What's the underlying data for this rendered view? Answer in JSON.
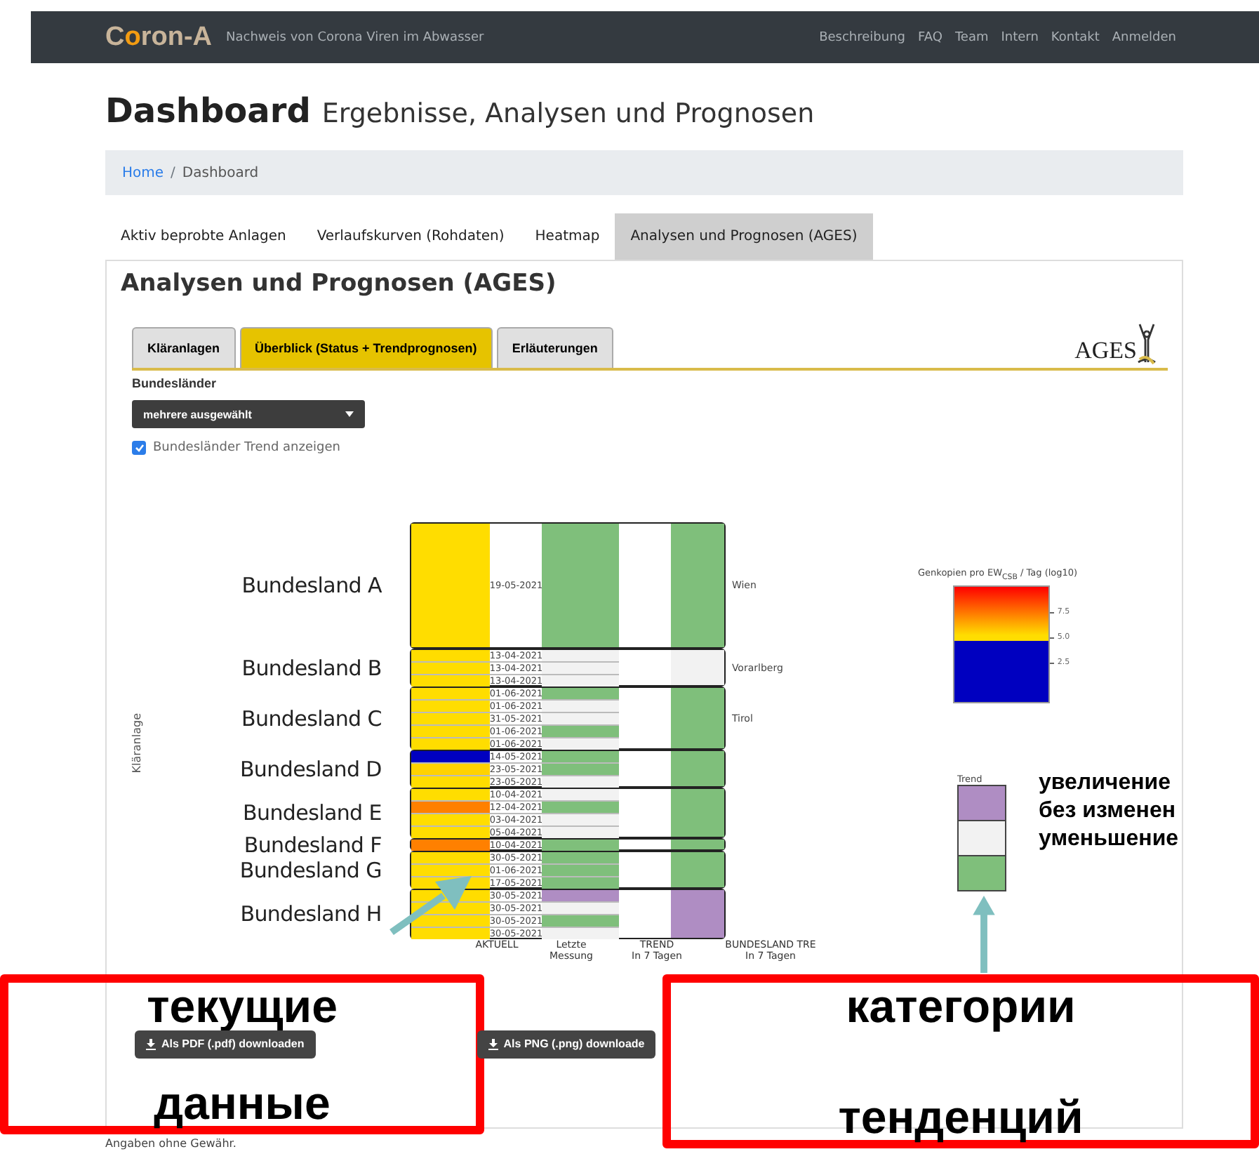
{
  "navbar": {
    "logo": "Coron-A",
    "tagline": "Nachweis von Corona Viren im Abwasser",
    "links": [
      "Beschreibung",
      "FAQ",
      "Team",
      "Intern",
      "Kontakt",
      "Anmelden"
    ]
  },
  "page_title": {
    "title": "Dashboard",
    "subtitle": "Ergebnisse, Analysen und Prognosen"
  },
  "breadcrumb": {
    "separator": "/",
    "items": [
      {
        "label": "Home",
        "kind": "link"
      },
      {
        "label": "Dashboard",
        "kind": "current"
      }
    ]
  },
  "tabs": [
    {
      "label": "Aktiv beprobte Anlagen",
      "selected": false
    },
    {
      "label": "Verlaufskurven (Rohdaten)",
      "selected": false
    },
    {
      "label": "Heatmap",
      "selected": false
    },
    {
      "label": "Analysen und Prognosen (AGES)",
      "selected": true
    }
  ],
  "panel": {
    "title": "Analysen und Prognosen (AGES)",
    "logo": "AGES",
    "subtabs": [
      {
        "label": "Kläranlagen",
        "selected": false
      },
      {
        "label": "Überblick (Status + Trendprognosen)",
        "selected": true
      },
      {
        "label": "Erläuterungen",
        "selected": false
      }
    ],
    "filter": {
      "label": "Bundesländer",
      "value": "mehrere ausgewählt"
    },
    "trend_checkbox": {
      "label": "Bundesländer Trend anzeigen",
      "checked": true
    },
    "heatmap": {
      "ylabel": "Kläranlage",
      "groups": [
        {
          "name": "Bundesland A",
          "region": "Wien",
          "trend": {
            "color": "#7fbf7b"
          },
          "rows": [
            {
              "date": "19-05-2021",
              "color": "#ffdd00",
              "trend": {
                "color": "#7fbf7b"
              }
            }
          ]
        },
        {
          "name": "Bundesland B",
          "region": "Vorarlberg",
          "trend": {
            "color": "#f2f2f2"
          },
          "rows": [
            {
              "date": "13-04-2021",
              "color": "#ffdd00",
              "trend": {
                "color": "#f2f2f2"
              }
            },
            {
              "date": "13-04-2021",
              "color": "#ffdd00",
              "trend": {
                "color": "#f2f2f2"
              }
            },
            {
              "date": "13-04-2021",
              "color": "#ffdd00",
              "trend": {
                "color": "#f2f2f2"
              }
            }
          ]
        },
        {
          "name": "Bundesland C",
          "region": "Tirol",
          "trend": {
            "color": "#7fbf7b"
          },
          "rows": [
            {
              "date": "01-06-2021",
              "color": "#ffdd00",
              "trend": {
                "color": "#7fbf7b"
              }
            },
            {
              "date": "01-06-2021",
              "color": "#ffdd00",
              "trend": {
                "color": "#f2f2f2"
              }
            },
            {
              "date": "31-05-2021",
              "color": "#ffdd00",
              "trend": {
                "color": "#f2f2f2"
              }
            },
            {
              "date": "01-06-2021",
              "color": "#ffdd00",
              "trend": {
                "color": "#7fbf7b"
              }
            },
            {
              "date": "01-06-2021",
              "color": "#ffdd00",
              "trend": {
                "color": "#f2f2f2"
              }
            }
          ]
        },
        {
          "name": "Bundesland D",
          "trend": {
            "color": "#7fbf7b"
          },
          "rows": [
            {
              "date": "14-05-2021",
              "color": "#0000c0",
              "trend": {
                "color": "#7fbf7b"
              }
            },
            {
              "date": "23-05-2021",
              "color": "#ffd200",
              "trend": {
                "color": "#7fbf7b"
              }
            },
            {
              "date": "23-05-2021",
              "color": "#ffdd00",
              "trend": {
                "color": "#f2f2f2"
              }
            }
          ]
        },
        {
          "name": "Bundesland E",
          "trend": {
            "color": "#7fbf7b"
          },
          "rows": [
            {
              "date": "10-04-2021",
              "color": "#ffdd00",
              "trend": {
                "color": "#f2f2f2"
              }
            },
            {
              "date": "12-04-2021",
              "color": "#ff8000",
              "trend": {
                "color": "#7fbf7b"
              }
            },
            {
              "date": "03-04-2021",
              "color": "#ffdd00",
              "trend": {
                "color": "#f2f2f2"
              }
            },
            {
              "date": "05-04-2021",
              "color": "#ffdd00",
              "trend": {
                "color": "#f2f2f2"
              }
            }
          ]
        },
        {
          "name": "Bundesland F",
          "trend": {
            "color": "#7fbf7b"
          },
          "rows": [
            {
              "date": "10-04-2021",
              "color": "#ff8000",
              "trend": {
                "color": "#7fbf7b"
              }
            }
          ]
        },
        {
          "name": "Bundesland G",
          "trend": {
            "color": "#7fbf7b"
          },
          "rows": [
            {
              "date": "30-05-2021",
              "color": "#ffdd00",
              "trend": {
                "color": "#7fbf7b"
              }
            },
            {
              "date": "01-06-2021",
              "color": "#ffdd00",
              "trend": {
                "color": "#7fbf7b"
              }
            },
            {
              "date": "17-05-2021",
              "color": "#ffdd00",
              "trend": {
                "color": "#7fbf7b"
              }
            }
          ]
        },
        {
          "name": "Bundesland H",
          "trend": {
            "color": "#af8dc3"
          },
          "rows": [
            {
              "date": "30-05-2021",
              "color": "#ffdd00",
              "trend": {
                "color": "#af8dc3"
              }
            },
            {
              "date": "30-05-2021",
              "color": "#ffdd00",
              "trend": {
                "color": "#f2f2f2"
              }
            },
            {
              "date": "30-05-2021",
              "color": "#ffdd00",
              "trend": {
                "color": "#7fbf7b"
              }
            },
            {
              "date": "30-05-2021",
              "color": "#ffdd00",
              "trend": {
                "color": "#f2f2f2"
              }
            }
          ]
        }
      ],
      "columns": [
        {
          "line1": "AKTUELL"
        },
        {
          "line1": "Letzte",
          "line2": "Messung"
        },
        {
          "line1": "TREND",
          "line2": "In 7 Tagen"
        },
        {
          "line1": "BUNDESLAND TRE",
          "line2": "In 7 Tagen"
        }
      ],
      "colorbar": {
        "title": "Genkopien pro EW$_{CSB}$ / Tag (log10)",
        "ticks": [
          "7.5",
          "5.0",
          "2.5"
        ]
      },
      "trend_legend": {
        "title": "Trend",
        "items": [
          {
            "color": "#af8dc3"
          },
          {
            "color": "#f2f2f2"
          },
          {
            "color": "#7fbf7b"
          }
        ]
      }
    },
    "downloads": [
      {
        "label": "Als PDF (.pdf) downloaden"
      },
      {
        "label": "Als PNG (.png) downloade"
      }
    ]
  },
  "footer": "Angaben ohne Gewähr.",
  "annotations": {
    "trend_labels": [
      "увеличение",
      "без изменен",
      "уменьшение"
    ],
    "boxes": [
      {
        "lines": [
          "текущие",
          "данные"
        ]
      },
      {
        "lines": [
          "категории",
          "тенденций"
        ]
      }
    ]
  }
}
